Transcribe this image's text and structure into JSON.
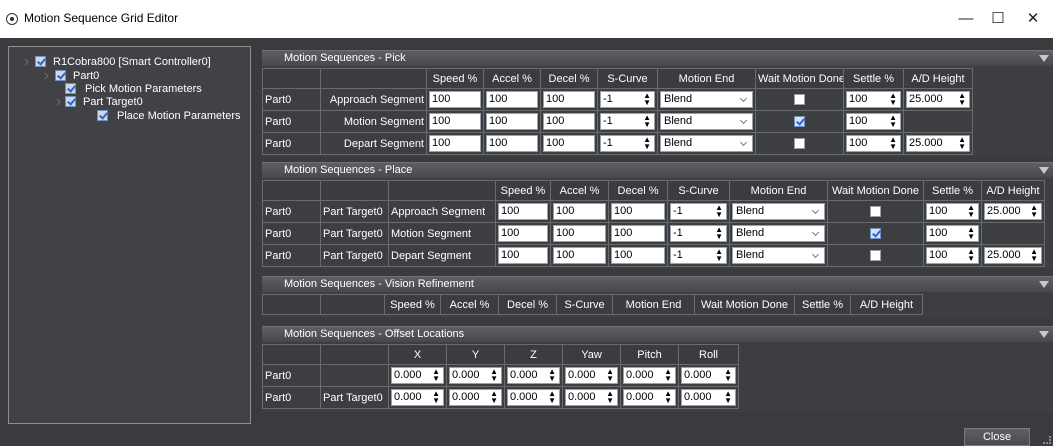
{
  "window": {
    "title": "Motion Sequence Grid Editor",
    "minimize": "—",
    "maximize": "☐",
    "close": "✕"
  },
  "tree": {
    "root": "R1Cobra800 [Smart Controller0]",
    "part": "Part0",
    "pick": "Pick Motion Parameters",
    "target": "Part Target0",
    "place": "Place Motion Parameters"
  },
  "pick": {
    "title": "Motion Sequences - Pick",
    "headers": [
      "Speed %",
      "Accel %",
      "Decel %",
      "S-Curve",
      "Motion End",
      "Wait Motion Done",
      "Settle %",
      "A/D Height"
    ],
    "rows": [
      {
        "part": "Part0",
        "segment": "Approach Segment",
        "speed": "100",
        "accel": "100",
        "decel": "100",
        "scurve": "-1",
        "end": "Blend",
        "settle": "100",
        "height": "25.000"
      },
      {
        "part": "Part0",
        "segment": "Motion Segment",
        "speed": "100",
        "accel": "100",
        "decel": "100",
        "scurve": "-1",
        "end": "Blend",
        "settle": "100",
        "height": ""
      },
      {
        "part": "Part0",
        "segment": "Depart Segment",
        "speed": "100",
        "accel": "100",
        "decel": "100",
        "scurve": "-1",
        "end": "Blend",
        "settle": "100",
        "height": "25.000"
      }
    ]
  },
  "place": {
    "title": "Motion Sequences - Place",
    "headers": [
      "Speed %",
      "Accel %",
      "Decel %",
      "S-Curve",
      "Motion End",
      "Wait Motion Done",
      "Settle %",
      "A/D Height"
    ],
    "rows": [
      {
        "part": "Part0",
        "target": "Part Target0",
        "segment": "Approach Segment",
        "speed": "100",
        "accel": "100",
        "decel": "100",
        "scurve": "-1",
        "end": "Blend",
        "settle": "100",
        "height": "25.000"
      },
      {
        "part": "Part0",
        "target": "Part Target0",
        "segment": "Motion Segment",
        "speed": "100",
        "accel": "100",
        "decel": "100",
        "scurve": "-1",
        "end": "Blend",
        "settle": "100",
        "height": ""
      },
      {
        "part": "Part0",
        "target": "Part Target0",
        "segment": "Depart Segment",
        "speed": "100",
        "accel": "100",
        "decel": "100",
        "scurve": "-1",
        "end": "Blend",
        "settle": "100",
        "height": "25.000"
      }
    ]
  },
  "vision": {
    "title": "Motion Sequences - Vision Refinement",
    "headers": [
      "Speed %",
      "Accel %",
      "Decel %",
      "S-Curve",
      "Motion End",
      "Wait Motion Done",
      "Settle %",
      "A/D Height"
    ]
  },
  "offset": {
    "title": "Motion Sequences - Offset Locations",
    "headers": [
      "X",
      "Y",
      "Z",
      "Yaw",
      "Pitch",
      "Roll"
    ],
    "rows": [
      {
        "part": "Part0",
        "target": "",
        "x": "0.000",
        "y": "0.000",
        "z": "0.000",
        "yaw": "0.000",
        "pitch": "0.000",
        "roll": "0.000"
      },
      {
        "part": "Part0",
        "target": "Part Target0",
        "x": "0.000",
        "y": "0.000",
        "z": "0.000",
        "yaw": "0.000",
        "pitch": "0.000",
        "roll": "0.000"
      }
    ]
  },
  "footer": {
    "close": "Close"
  }
}
